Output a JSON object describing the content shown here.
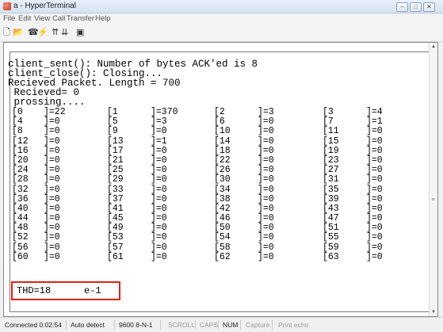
{
  "window": {
    "title": "a - HyperTerminal",
    "minimize": "‒",
    "maximize": "□",
    "close": "✕"
  },
  "menu": [
    "File",
    "Edit",
    "View",
    "Call",
    "Transfer",
    "Help"
  ],
  "toolbar_icons": [
    "new-icon",
    "open-icon",
    "connect-icon",
    "disconnect-icon",
    "send-icon",
    "receive-icon",
    "properties-icon"
  ],
  "terminal": {
    "lines": [
      "client_sent(): Number of bytes ACK'ed is 8",
      "client_close(): Closing...",
      "Recieved Packet. Length = 700",
      " Recieved= 0",
      " prossing...."
    ],
    "rows": [
      [
        [
          "[0",
          "]=22"
        ],
        [
          "[1",
          "]=370"
        ],
        [
          "[2",
          "]=3"
        ],
        [
          "[3",
          "]=4"
        ]
      ],
      [
        [
          "[4",
          "]=0"
        ],
        [
          "[5",
          "]=3"
        ],
        [
          "[6",
          "]=0"
        ],
        [
          "[7",
          "]=1"
        ]
      ],
      [
        [
          "[8",
          "]=0"
        ],
        [
          "[9",
          "]=0"
        ],
        [
          "[10",
          "]=0"
        ],
        [
          "[11",
          "]=0"
        ]
      ],
      [
        [
          "[12",
          "]=0"
        ],
        [
          "[13",
          "]=1"
        ],
        [
          "[14",
          "]=0"
        ],
        [
          "[15",
          "]=0"
        ]
      ],
      [
        [
          "[16",
          "]=0"
        ],
        [
          "[17",
          "]=0"
        ],
        [
          "[18",
          "]=0"
        ],
        [
          "[19",
          "]=0"
        ]
      ],
      [
        [
          "[20",
          "]=0"
        ],
        [
          "[21",
          "]=0"
        ],
        [
          "[22",
          "]=0"
        ],
        [
          "[23",
          "]=0"
        ]
      ],
      [
        [
          "[24",
          "]=0"
        ],
        [
          "[25",
          "]=0"
        ],
        [
          "[26",
          "]=0"
        ],
        [
          "[27",
          "]=0"
        ]
      ],
      [
        [
          "[28",
          "]=0"
        ],
        [
          "[29",
          "]=0"
        ],
        [
          "[30",
          "]=0"
        ],
        [
          "[31",
          "]=0"
        ]
      ],
      [
        [
          "[32",
          "]=0"
        ],
        [
          "[33",
          "]=0"
        ],
        [
          "[34",
          "]=0"
        ],
        [
          "[35",
          "]=0"
        ]
      ],
      [
        [
          "[36",
          "]=0"
        ],
        [
          "[37",
          "]=0"
        ],
        [
          "[38",
          "]=0"
        ],
        [
          "[39",
          "]=0"
        ]
      ],
      [
        [
          "[40",
          "]=0"
        ],
        [
          "[41",
          "]=0"
        ],
        [
          "[42",
          "]=0"
        ],
        [
          "[43",
          "]=0"
        ]
      ],
      [
        [
          "[44",
          "]=0"
        ],
        [
          "[45",
          "]=0"
        ],
        [
          "[46",
          "]=0"
        ],
        [
          "[47",
          "]=0"
        ]
      ],
      [
        [
          "[48",
          "]=0"
        ],
        [
          "[49",
          "]=0"
        ],
        [
          "[50",
          "]=0"
        ],
        [
          "[51",
          "]=0"
        ]
      ],
      [
        [
          "[52",
          "]=0"
        ],
        [
          "[53",
          "]=0"
        ],
        [
          "[54",
          "]=0"
        ],
        [
          "[55",
          "]=0"
        ]
      ],
      [
        [
          "[56",
          "]=0"
        ],
        [
          "[57",
          "]=0"
        ],
        [
          "[58",
          "]=0"
        ],
        [
          "[59",
          "]=0"
        ]
      ],
      [
        [
          "[60",
          "]=0"
        ],
        [
          "[61",
          "]=0"
        ],
        [
          "[62",
          "]=0"
        ],
        [
          "[63",
          "]=0"
        ]
      ]
    ],
    "thd_label": "THD=18",
    "thd_unit": "e-1",
    "highlight_color": "#e02020"
  },
  "status": {
    "connected": "Connected 0:02:54",
    "detect": "Auto detect",
    "settings": "9600 8-N-1",
    "scroll": "SCROLL",
    "caps": "CAPS",
    "num": "NUM",
    "capture": "Capture",
    "print_echo": "Print echo"
  }
}
